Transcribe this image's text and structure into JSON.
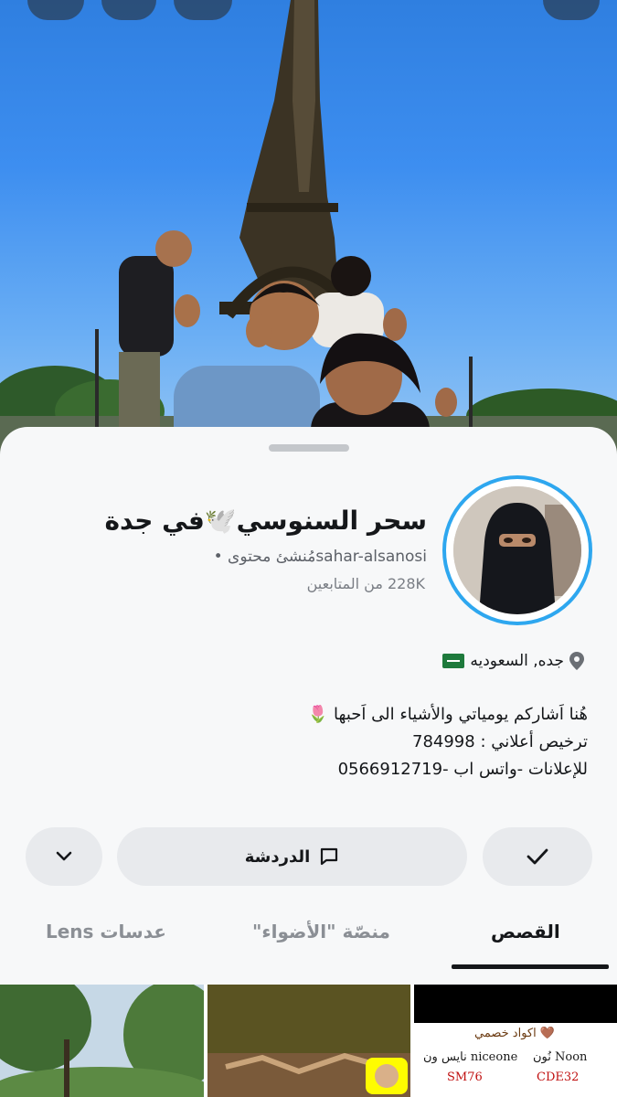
{
  "profile": {
    "display_name": "سحر السنوسي🕊️في جدة",
    "username": "sahar-alsanosi",
    "creator_label": "مُنشئ محتوى •",
    "followers": "228K من المتابعين",
    "location": "جده, السعوديه",
    "bio_lines": [
      "هُنا اَشاركم يومياتي والأشياء الى اَحبها 🌷",
      "ترخيص أعلاني : 784998",
      "للإعلانات -واتس اب -0566912719"
    ]
  },
  "actions": {
    "chat_label": "الدردشة"
  },
  "tabs": [
    {
      "label": "القصص",
      "active": true
    },
    {
      "label": "منصّة \"الأضواء\"",
      "active": false
    },
    {
      "label": "عدسات Lens",
      "active": false
    }
  ],
  "thumb3": {
    "heading": "اكواد خصمي 🤎",
    "noon_label": "نُون Noon",
    "noon_code": "CDE32",
    "nice_label": "نايس ون niceone",
    "nice_code": "SM76"
  },
  "colors": {
    "ring": "#2ea7ef",
    "sheet": "#f7f8f9",
    "button": "#e8eaed"
  },
  "icons": [
    "pin-icon",
    "flag-icon",
    "chevron-down-icon",
    "chat-icon",
    "check-icon"
  ]
}
